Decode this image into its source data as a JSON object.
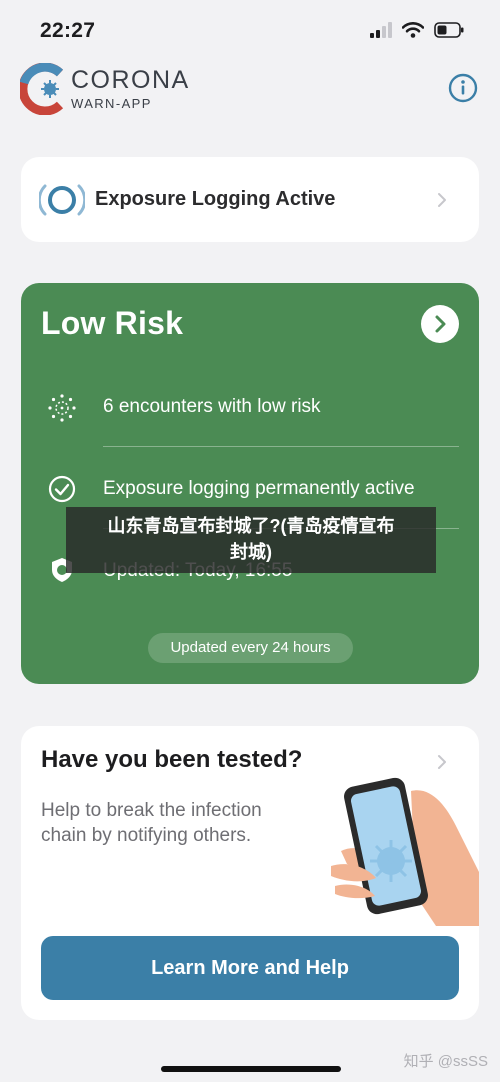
{
  "status_bar": {
    "time": "22:27"
  },
  "header": {
    "logo_title": "CORONA",
    "logo_subtitle": "WARN-APP"
  },
  "exposure_card": {
    "label": "Exposure Logging Active"
  },
  "risk_card": {
    "title": "Low Risk",
    "rows": [
      {
        "icon": "virus-icon",
        "text": "6 encounters with low risk"
      },
      {
        "icon": "check-circle-icon",
        "text": "Exposure logging permanently active"
      },
      {
        "icon": "shield-icon",
        "text": "Updated: Today, 16:55"
      }
    ],
    "interval_label": "Updated every 24 hours"
  },
  "tested_card": {
    "heading": "Have you been tested?",
    "text": "Help to break the infection chain by notifying others.",
    "button_label": "Learn More and Help"
  },
  "overlay": {
    "line1": "山东青岛宣布封城了?(青岛疫情宣布",
    "line2": "封城)"
  },
  "watermark": "知乎 @ssSS",
  "colors": {
    "risk_green": "#4b8b54",
    "button_blue": "#3b7fa7",
    "logo_blue": "#4a8cb8",
    "logo_red": "#c8453a",
    "background": "#f2f2f4"
  }
}
